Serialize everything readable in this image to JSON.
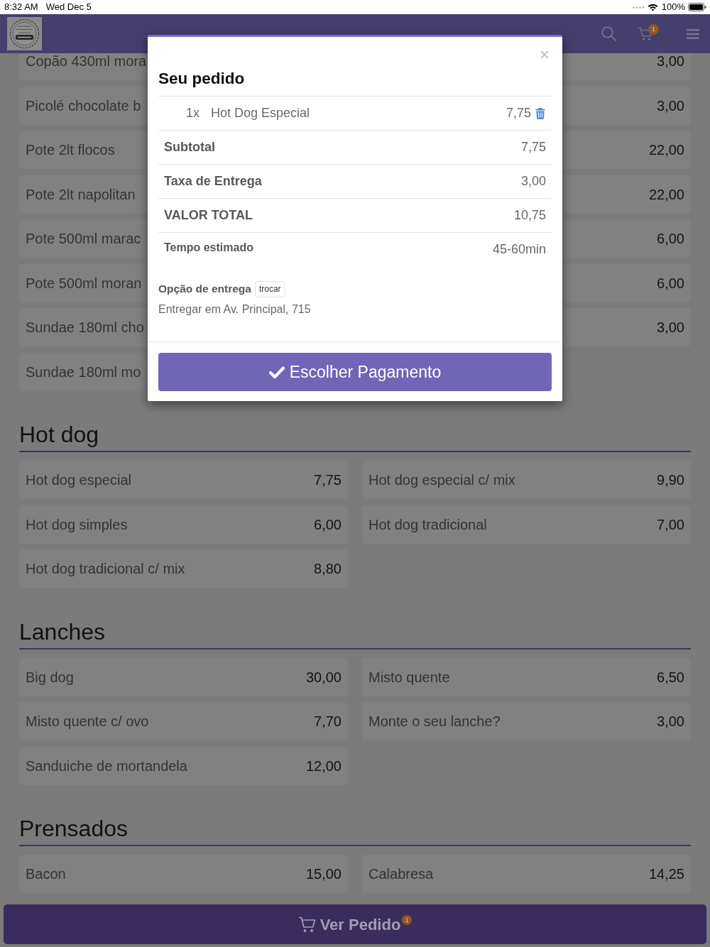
{
  "status_bar": {
    "time": "8:32 AM",
    "date": "Wed Dec 5",
    "battery": "100%"
  },
  "navbar": {
    "cart_badge": "1"
  },
  "sections": [
    {
      "items": [
        {
          "name": "Copão 430ml mora"
        },
        {
          "price": "3,00"
        },
        {
          "name": "Picolé chocolate b"
        },
        {
          "price": "3,00"
        },
        {
          "name": "Pote 2lt flocos"
        },
        {
          "price": "22,00"
        },
        {
          "name": "Pote 2lt napolitan"
        },
        {
          "price": "22,00"
        },
        {
          "name": "Pote 500ml marac"
        },
        {
          "price": "6,00"
        },
        {
          "name": "Pote 500ml moran"
        },
        {
          "price": "6,00"
        },
        {
          "name": "Sundae 180ml cho"
        },
        {
          "price": "3,00"
        },
        {
          "name": "Sundae 180ml mo"
        }
      ]
    },
    {
      "title": "Hot dog",
      "items": [
        {
          "name": "Hot dog especial",
          "price": "7,75"
        },
        {
          "name": "Hot dog especial c/ mix",
          "price": "9,90"
        },
        {
          "name": "Hot dog simples",
          "price": "6,00"
        },
        {
          "name": "Hot dog tradicional",
          "price": "7,00"
        },
        {
          "name": "Hot dog tradicional c/ mix",
          "price": "8,80"
        }
      ]
    },
    {
      "title": "Lanches",
      "items": [
        {
          "name": "Big dog",
          "price": "30,00"
        },
        {
          "name": "Misto quente",
          "price": "6,50"
        },
        {
          "name": "Misto quente c/ ovo",
          "price": "7,70"
        },
        {
          "name": "Monte o seu lanche?",
          "price": "3,00"
        },
        {
          "name": "Sanduiche de mortandela",
          "price": "12,00"
        }
      ]
    },
    {
      "title": "Prensados",
      "items": [
        {
          "name": "Bacon",
          "price": "15,00"
        },
        {
          "name": "Calabresa",
          "price": "14,25"
        }
      ]
    }
  ],
  "modal": {
    "title": "Seu pedido",
    "order_items": [
      {
        "quantity": "1x",
        "name": "Hot Dog Especial",
        "price": "7,75"
      }
    ],
    "summary": [
      {
        "kind": "amount",
        "label": "Subtotal",
        "value": "7,75"
      },
      {
        "kind": "amount",
        "label": "Taxa de Entrega",
        "value": "3,00"
      },
      {
        "kind": "amount",
        "label": "VALOR TOTAL",
        "value": "10,75"
      },
      {
        "kind": "estimate",
        "label": "Tempo estimado",
        "value": "45-60min"
      }
    ],
    "delivery": {
      "label": "Opção de entrega",
      "change_button": "trocar",
      "address": "Entregar em Av. Principal, 715"
    },
    "confirm_button": "Escolher Pagamento"
  },
  "bottom_bar": {
    "label": "Ver Pedido",
    "badge": "1"
  }
}
